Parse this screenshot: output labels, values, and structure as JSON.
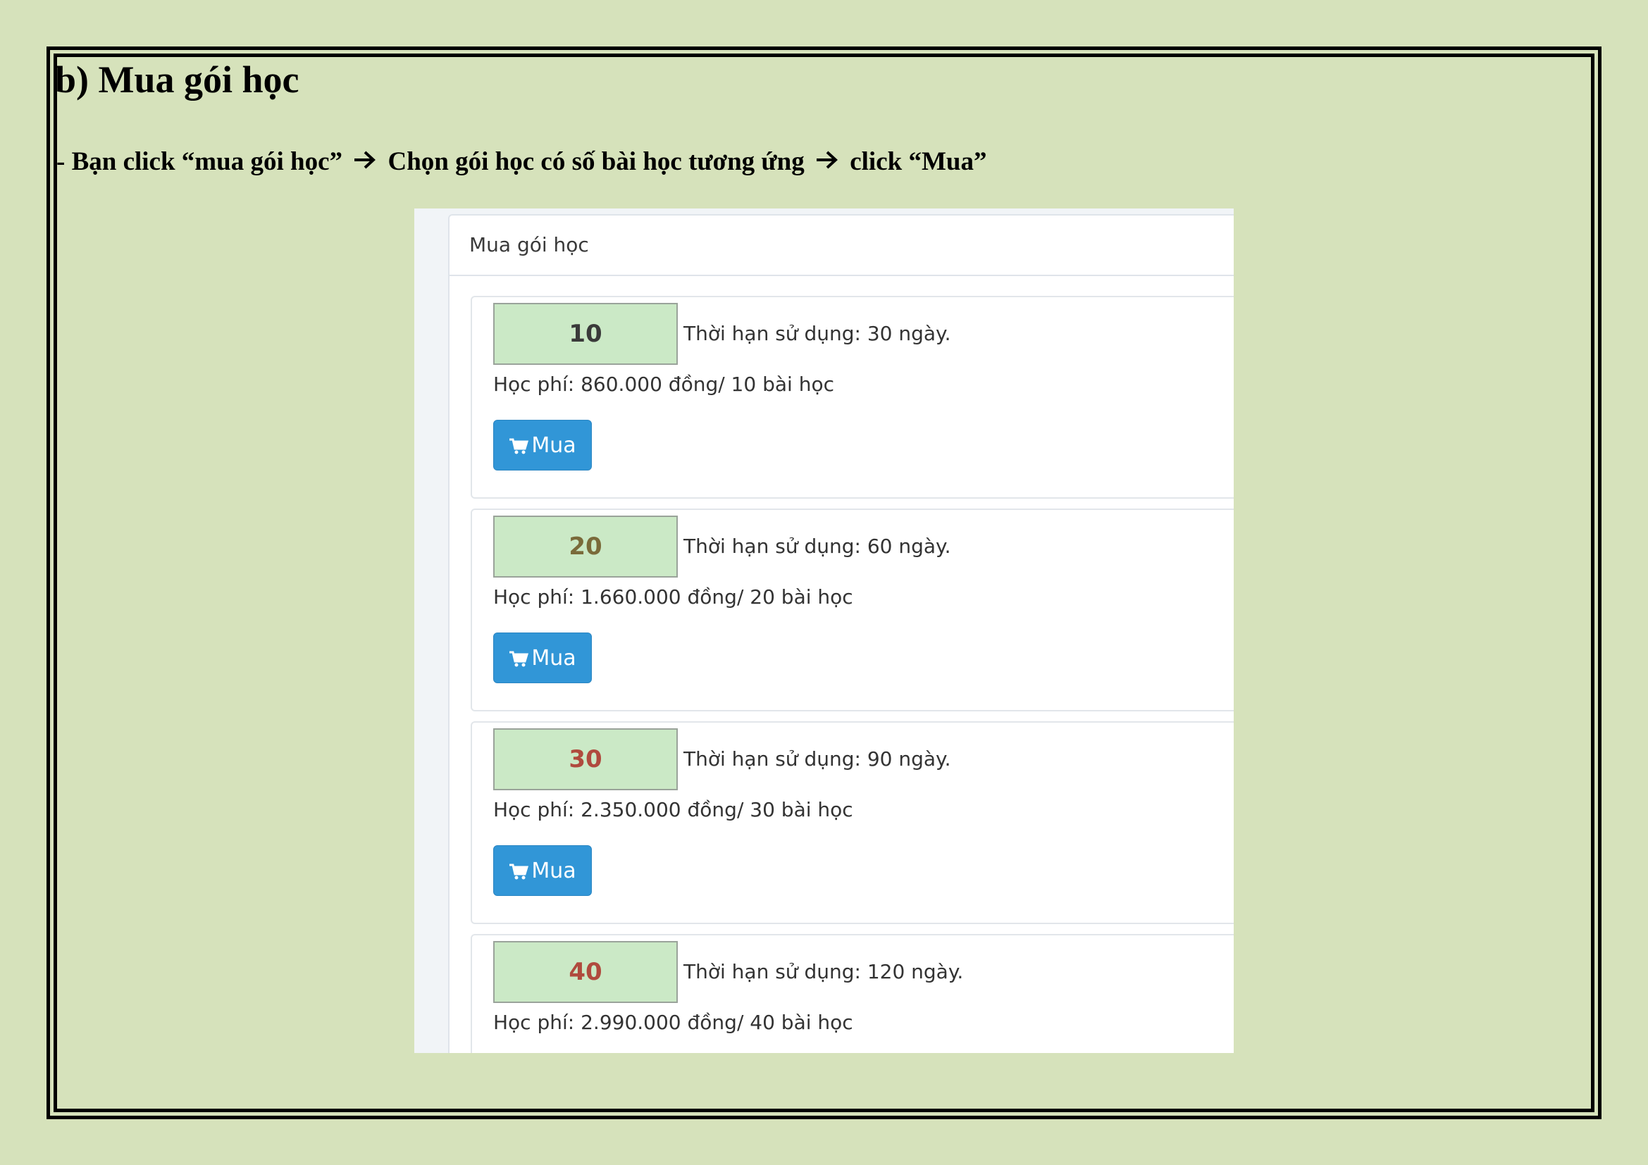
{
  "document": {
    "heading": "b) Mua gói học",
    "instruction": {
      "part1": "- Bạn click “mua gói học” ",
      "part2": " Chọn gói học có số bài học tương ứng ",
      "part3": " click “Mua”",
      "arrow_icon": "right-arrow-icon"
    }
  },
  "screenshot": {
    "panel_title": "Mua gói học",
    "packages": [
      {
        "count": "10",
        "count_color": "#3a3a3a",
        "duration": "Thời hạn sử dụng: 30 ngày.",
        "fee": "Học phí: 860.000 đồng/ 10 bài học",
        "button_label": "Mua",
        "button_icon": "shopping-cart-icon"
      },
      {
        "count": "20",
        "count_color": "#7a6a3a",
        "duration": "Thời hạn sử dụng: 60 ngày.",
        "fee": "Học phí: 1.660.000 đồng/ 20 bài học",
        "button_label": "Mua",
        "button_icon": "shopping-cart-icon"
      },
      {
        "count": "30",
        "count_color": "#b04a3e",
        "duration": "Thời hạn sử dụng: 90 ngày.",
        "fee": "Học phí: 2.350.000 đồng/ 30 bài học",
        "button_label": "Mua",
        "button_icon": "shopping-cart-icon"
      },
      {
        "count": "40",
        "count_color": "#b04a3e",
        "duration": "Thời hạn sử dụng: 120 ngày.",
        "fee": "Học phí: 2.990.000 đồng/ 40 bài học"
      }
    ],
    "colors": {
      "page_background": "#d6e2bb",
      "badge_background": "#cbe9c6",
      "button_background": "#3196d7"
    }
  }
}
